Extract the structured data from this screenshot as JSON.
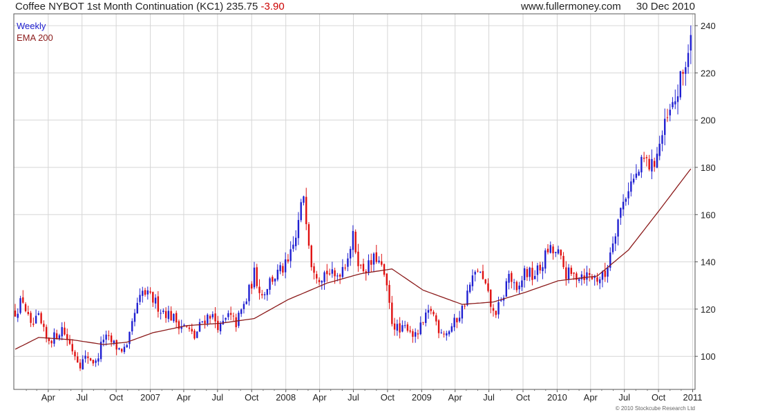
{
  "header": {
    "title": "Coffee NYBOT 1st Month Continuation (KC1)",
    "last": "235.75",
    "change": "-3.90",
    "site": "www.fullermoney.com",
    "date": "30 Dec 2010"
  },
  "copyright": "© 2010 Stockcube Research Ltd",
  "colors": {
    "up": "#1f1fd1",
    "down": "#e01010",
    "ema": "#8b1a1a",
    "grid": "#d6d6d6",
    "change": "#cc0000"
  },
  "chart_data": {
    "type": "candlestick",
    "legend": [
      {
        "label": "Weekly",
        "color": "#1f1fd1"
      },
      {
        "label": "EMA 200",
        "color": "#8b1a1a"
      }
    ],
    "x_tick_labels": [
      "Apr",
      "Jul",
      "Oct",
      "2007",
      "Apr",
      "Jul",
      "Oct",
      "2008",
      "Apr",
      "Jul",
      "Oct",
      "2009",
      "Apr",
      "Jul",
      "Oct",
      "2010",
      "Apr",
      "Jul",
      "Oct",
      "2011"
    ],
    "y_ticks": [
      100,
      120,
      140,
      160,
      180,
      200,
      220,
      240
    ],
    "ylim": [
      86,
      245
    ],
    "x_range": [
      "2006-01-02",
      "2010-12-31"
    ],
    "grid": true,
    "legend_position": "top-left",
    "anchors": [
      [
        "2006-01-02",
        119
      ],
      [
        "2006-01-23",
        124
      ],
      [
        "2006-02-13",
        112
      ],
      [
        "2006-03-06",
        116
      ],
      [
        "2006-03-27",
        107
      ],
      [
        "2006-04-17",
        108
      ],
      [
        "2006-05-08",
        112
      ],
      [
        "2006-06-05",
        103
      ],
      [
        "2006-06-26",
        97
      ],
      [
        "2006-07-17",
        100
      ],
      [
        "2006-08-07",
        97
      ],
      [
        "2006-08-28",
        108
      ],
      [
        "2006-09-18",
        106
      ],
      [
        "2006-10-09",
        103
      ],
      [
        "2006-10-30",
        103
      ],
      [
        "2006-11-20",
        118
      ],
      [
        "2006-12-11",
        127
      ],
      [
        "2007-01-08",
        124
      ],
      [
        "2007-01-29",
        120
      ],
      [
        "2007-02-19",
        118
      ],
      [
        "2007-03-19",
        114
      ],
      [
        "2007-04-09",
        112
      ],
      [
        "2007-04-30",
        108
      ],
      [
        "2007-05-21",
        115
      ],
      [
        "2007-06-11",
        118
      ],
      [
        "2007-07-09",
        112
      ],
      [
        "2007-07-30",
        117
      ],
      [
        "2007-08-20",
        114
      ],
      [
        "2007-09-17",
        124
      ],
      [
        "2007-10-08",
        135
      ],
      [
        "2007-10-29",
        126
      ],
      [
        "2007-11-19",
        132
      ],
      [
        "2007-12-17",
        136
      ],
      [
        "2008-01-07",
        139
      ],
      [
        "2008-01-28",
        150
      ],
      [
        "2008-02-18",
        169
      ],
      [
        "2008-03-10",
        140
      ],
      [
        "2008-03-31",
        134
      ],
      [
        "2008-04-21",
        136
      ],
      [
        "2008-05-12",
        133
      ],
      [
        "2008-06-09",
        140
      ],
      [
        "2008-06-30",
        150
      ],
      [
        "2008-07-21",
        137
      ],
      [
        "2008-08-11",
        138
      ],
      [
        "2008-09-01",
        142
      ],
      [
        "2008-09-22",
        134
      ],
      [
        "2008-10-13",
        115
      ],
      [
        "2008-11-03",
        110
      ],
      [
        "2008-11-24",
        113
      ],
      [
        "2008-12-15",
        108
      ],
      [
        "2009-01-05",
        114
      ],
      [
        "2009-01-26",
        120
      ],
      [
        "2009-02-16",
        112
      ],
      [
        "2009-03-09",
        110
      ],
      [
        "2009-03-30",
        114
      ],
      [
        "2009-04-20",
        120
      ],
      [
        "2009-05-11",
        130
      ],
      [
        "2009-06-01",
        137
      ],
      [
        "2009-06-22",
        129
      ],
      [
        "2009-07-13",
        118
      ],
      [
        "2009-08-03",
        122
      ],
      [
        "2009-08-24",
        135
      ],
      [
        "2009-09-14",
        126
      ],
      [
        "2009-10-05",
        136
      ],
      [
        "2009-10-26",
        134
      ],
      [
        "2009-11-16",
        137
      ],
      [
        "2009-12-07",
        145
      ],
      [
        "2010-01-04",
        143
      ],
      [
        "2010-01-25",
        135
      ],
      [
        "2010-02-15",
        134
      ],
      [
        "2010-03-08",
        135
      ],
      [
        "2010-03-29",
        134
      ],
      [
        "2010-04-19",
        133
      ],
      [
        "2010-05-10",
        134
      ],
      [
        "2010-05-31",
        150
      ],
      [
        "2010-06-21",
        162
      ],
      [
        "2010-07-12",
        172
      ],
      [
        "2010-08-02",
        176
      ],
      [
        "2010-08-23",
        183
      ],
      [
        "2010-09-13",
        180
      ],
      [
        "2010-10-04",
        190
      ],
      [
        "2010-10-25",
        200
      ],
      [
        "2010-11-15",
        208
      ],
      [
        "2010-12-06",
        220
      ],
      [
        "2010-12-30",
        235.75
      ]
    ],
    "ema200": [
      [
        "2006-01-02",
        103
      ],
      [
        "2006-03-06",
        108
      ],
      [
        "2006-06-05",
        107
      ],
      [
        "2006-08-28",
        105
      ],
      [
        "2006-10-30",
        106
      ],
      [
        "2007-01-08",
        110
      ],
      [
        "2007-04-09",
        113
      ],
      [
        "2007-07-09",
        114
      ],
      [
        "2007-10-08",
        116
      ],
      [
        "2008-01-07",
        124
      ],
      [
        "2008-04-21",
        131
      ],
      [
        "2008-07-21",
        135
      ],
      [
        "2008-10-13",
        137
      ],
      [
        "2009-01-05",
        128
      ],
      [
        "2009-04-20",
        122
      ],
      [
        "2009-07-13",
        123
      ],
      [
        "2009-10-05",
        127
      ],
      [
        "2010-01-04",
        132
      ],
      [
        "2010-04-19",
        134
      ],
      [
        "2010-07-12",
        145
      ],
      [
        "2010-10-04",
        162
      ],
      [
        "2010-12-30",
        180
      ]
    ]
  }
}
